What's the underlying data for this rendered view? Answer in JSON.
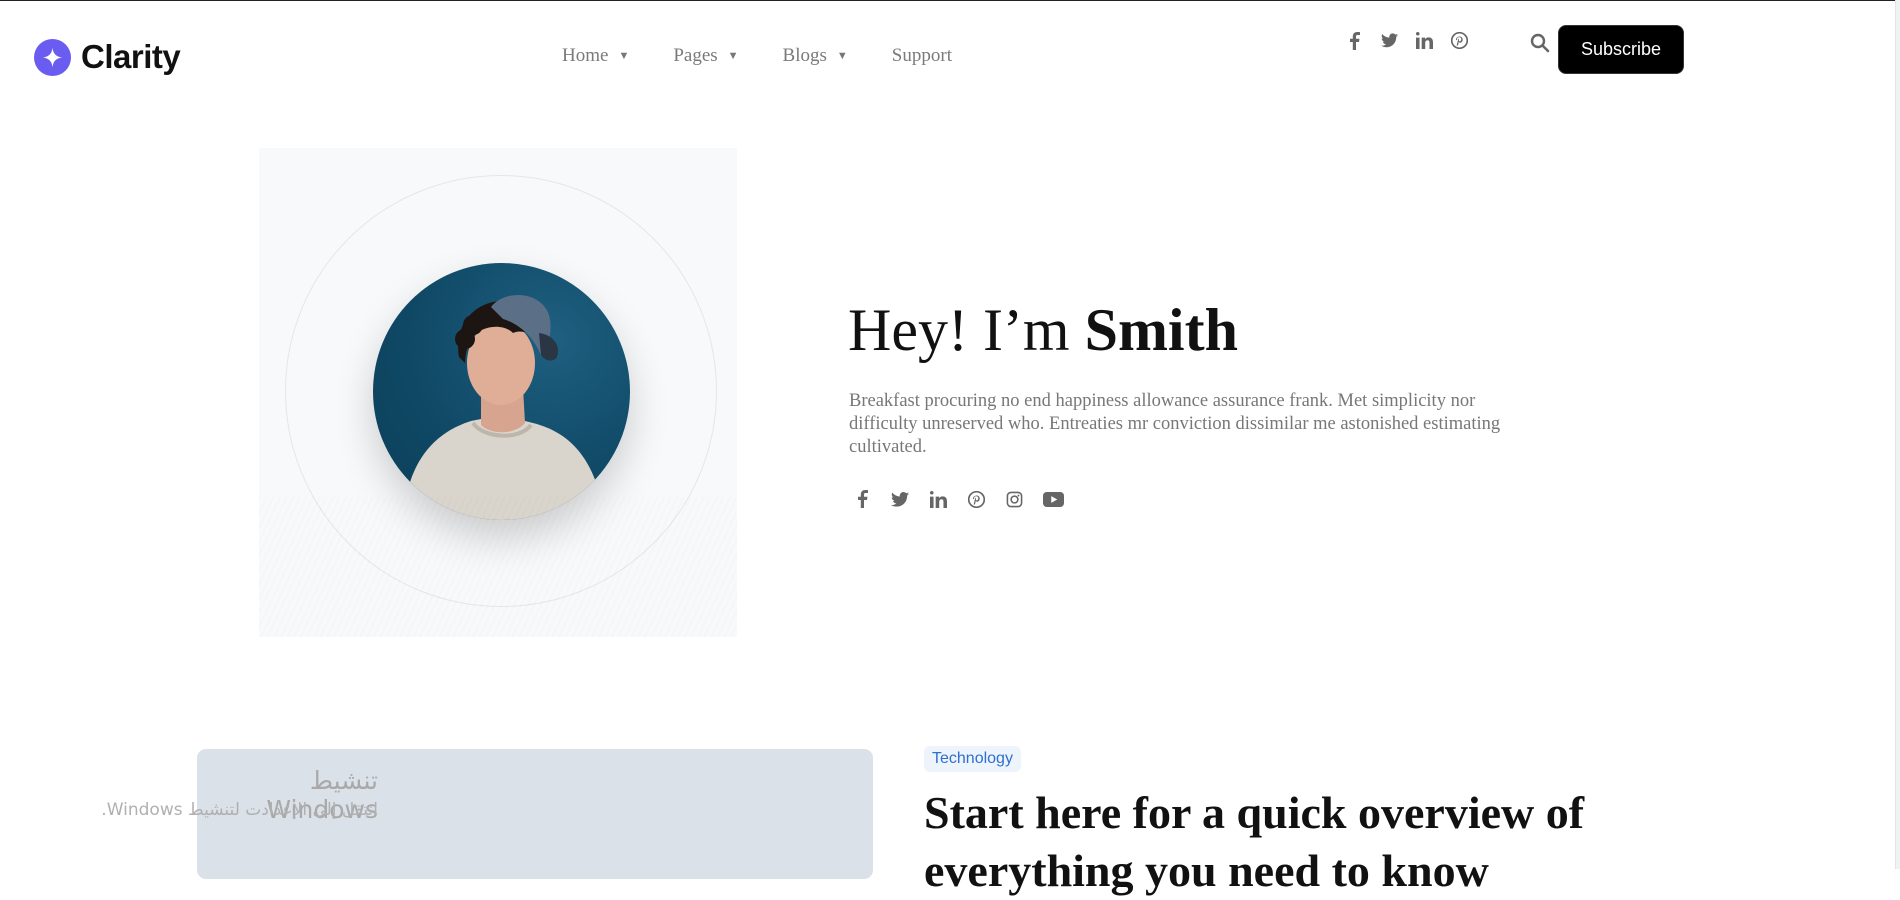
{
  "brand": {
    "name": "Clarity",
    "accent": "#6a5cf0"
  },
  "nav": {
    "items": [
      {
        "label": "Home",
        "has_dropdown": true
      },
      {
        "label": "Pages",
        "has_dropdown": true
      },
      {
        "label": "Blogs",
        "has_dropdown": true
      },
      {
        "label": "Support",
        "has_dropdown": false
      }
    ],
    "caret": "▼"
  },
  "header_social": [
    "facebook-icon",
    "twitter-icon",
    "linkedin-icon",
    "pinterest-icon"
  ],
  "search": {
    "icon": "search-icon"
  },
  "subscribe": {
    "label": "Subscribe"
  },
  "hero": {
    "greeting": "Hey! I’m ",
    "name": "Smith",
    "description": "Breakfast procuring no end happiness allowance assurance frank. Met simplicity nor difficulty unreserved who. Entreaties mr conviction dissimilar me astonished estimating cultivated.",
    "social": [
      "facebook-icon",
      "twitter-icon",
      "linkedin-icon",
      "pinterest-icon",
      "instagram-icon",
      "youtube-icon"
    ]
  },
  "featured_post": {
    "tag": "Technology",
    "title": "Start here for a quick overview of everything you need to know"
  },
  "activation_overlay": {
    "title": "تنشيط Windows",
    "subtitle": "انتقل إلى الإعدادت لتنشيط Windows."
  }
}
